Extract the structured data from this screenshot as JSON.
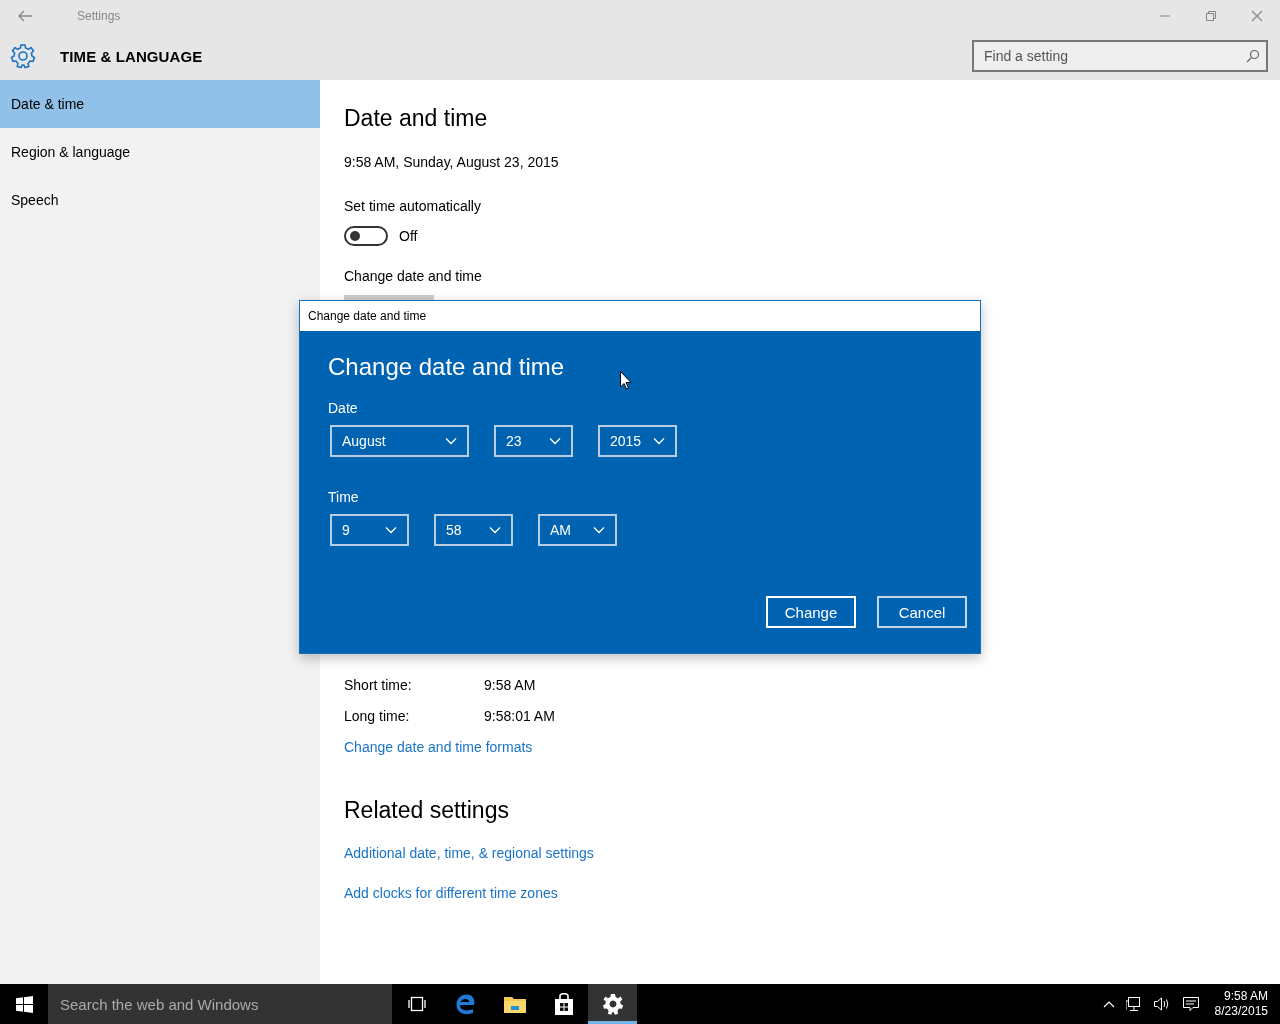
{
  "window": {
    "title": "Settings"
  },
  "header": {
    "title": "TIME & LANGUAGE"
  },
  "search": {
    "placeholder": "Find a setting"
  },
  "sidebar": {
    "items": [
      {
        "label": "Date & time",
        "selected": true
      },
      {
        "label": "Region & language",
        "selected": false
      },
      {
        "label": "Speech",
        "selected": false
      }
    ]
  },
  "content": {
    "title": "Date and time",
    "current": "9:58 AM, Sunday, August 23, 2015",
    "auto_time": {
      "label": "Set time automatically",
      "on": false,
      "state_text": "Off"
    },
    "change_label": "Change date and time",
    "formats": [
      {
        "label": "Short time:",
        "value": "9:58 AM"
      },
      {
        "label": "Long time:",
        "value": "9:58:01 AM"
      }
    ],
    "formats_link": "Change date and time formats",
    "related": {
      "title": "Related settings",
      "links": [
        "Additional date, time, & regional settings",
        "Add clocks for different time zones"
      ]
    }
  },
  "dialog": {
    "window_title": "Change date and time",
    "heading": "Change date and time",
    "date_label": "Date",
    "date": [
      "August",
      "23",
      "2015"
    ],
    "time_label": "Time",
    "time": [
      "9",
      "58",
      "AM"
    ],
    "buttons": [
      {
        "label": "Change",
        "kind": "primary"
      },
      {
        "label": "Cancel",
        "kind": "secondary"
      }
    ]
  },
  "taskbar": {
    "search_placeholder": "Search the web and Windows",
    "apps": [
      {
        "kind": "task-view",
        "selected": false
      },
      {
        "kind": "browser",
        "selected": false
      },
      {
        "kind": "folder",
        "selected": false
      },
      {
        "kind": "store",
        "selected": false
      },
      {
        "kind": "settings",
        "selected": true
      }
    ],
    "clock": {
      "time": "9:58 AM",
      "date": "8/23/2015"
    }
  }
}
